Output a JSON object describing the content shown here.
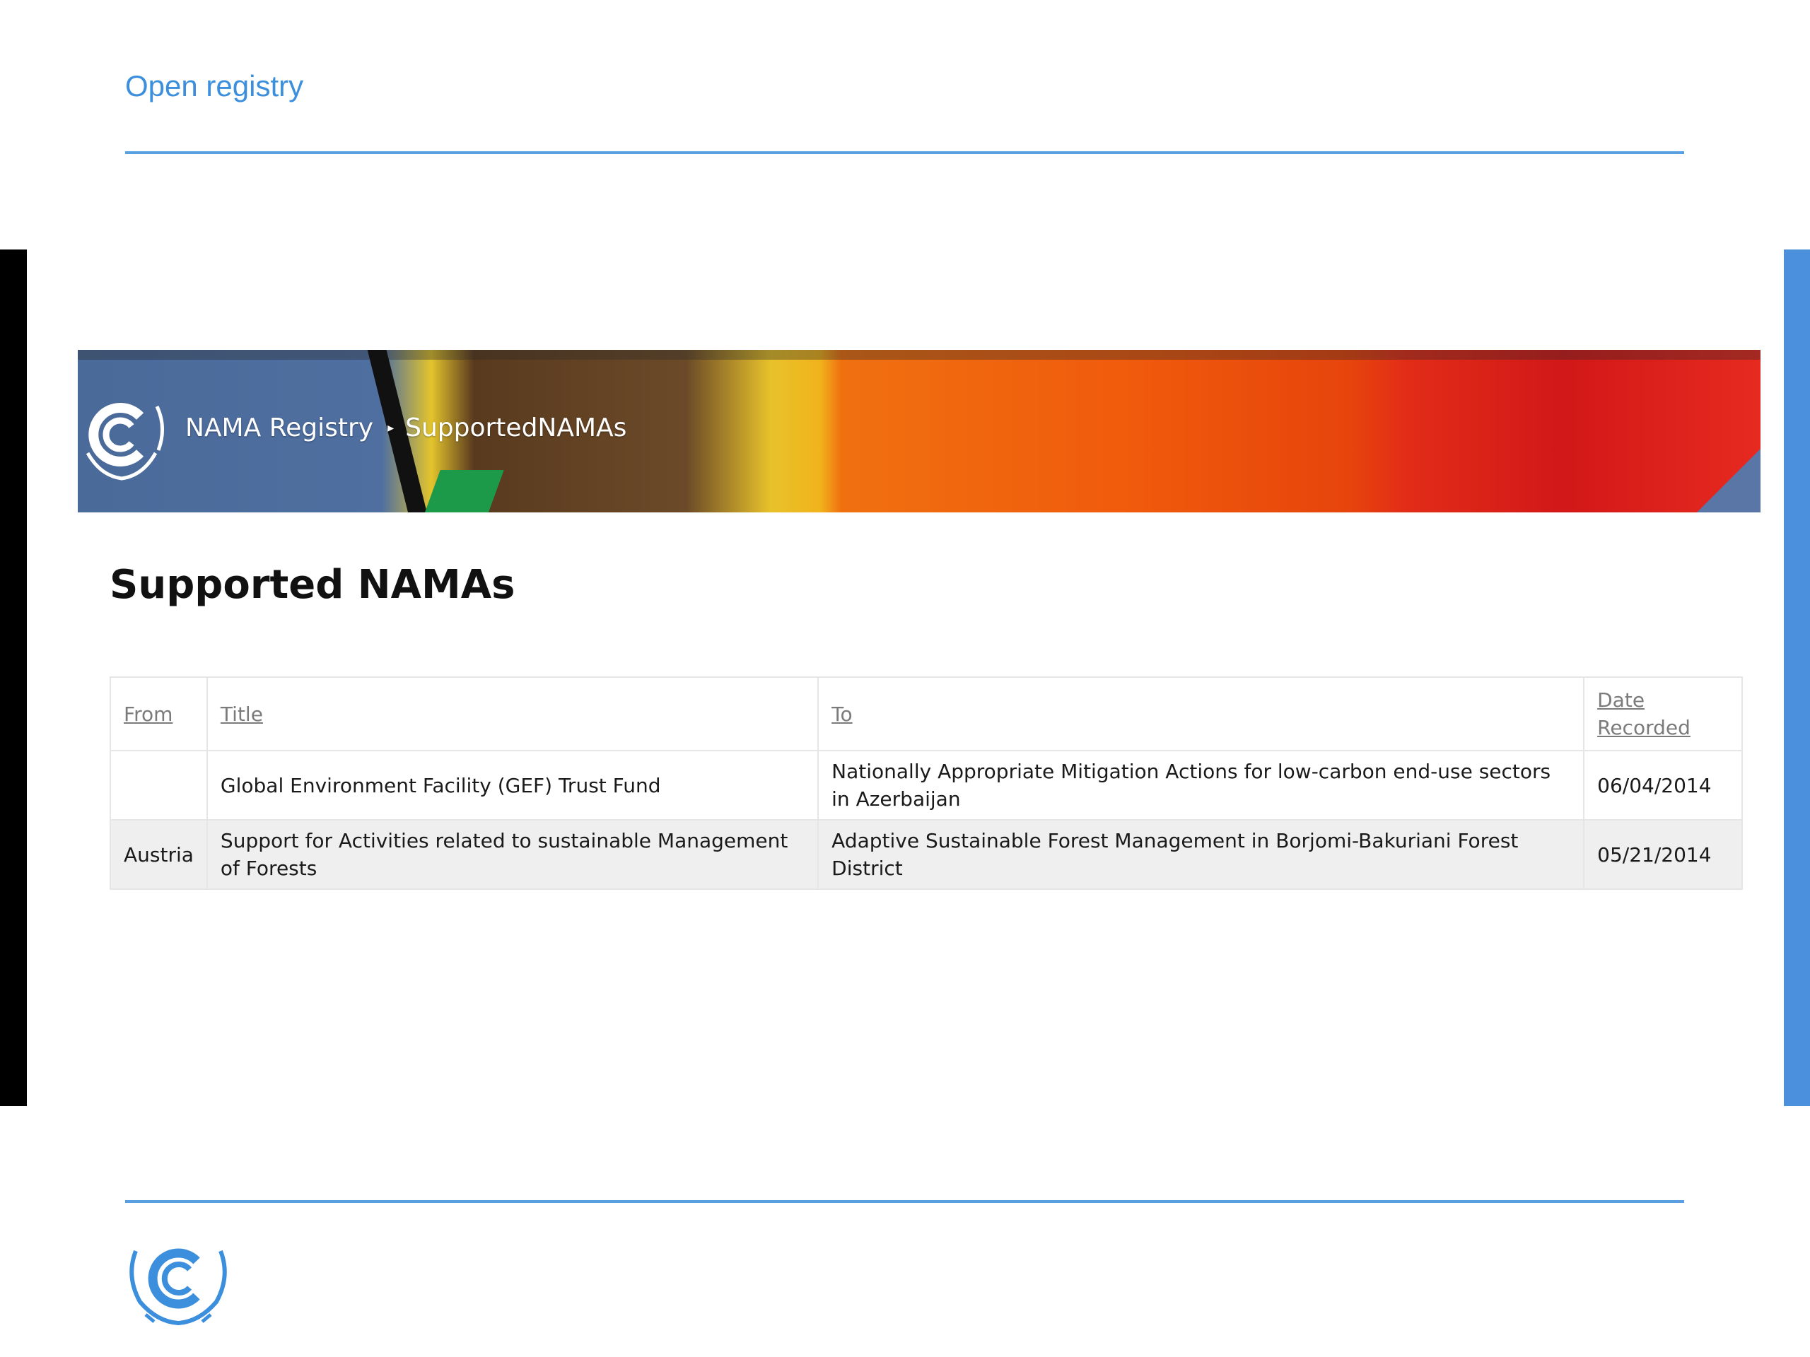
{
  "slide": {
    "title": "Open registry"
  },
  "banner": {
    "breadcrumb": [
      {
        "label": "NAMA Registry"
      },
      {
        "label": "SupportedNAMAs"
      }
    ]
  },
  "page": {
    "heading": "Supported NAMAs"
  },
  "table": {
    "headers": {
      "from": "From",
      "title": "Title",
      "to": "To",
      "date_recorded": "Date Recorded"
    },
    "rows": [
      {
        "from": "",
        "title": "Global Environment Facility (GEF) Trust Fund",
        "to": "Nationally Appropriate Mitigation Actions for low-carbon end-use sectors in Azerbaijan",
        "date_recorded": "06/04/2014"
      },
      {
        "from": "Austria",
        "title": "Support for Activities related to sustainable Management of Forests",
        "to": "Adaptive Sustainable Forest Management in Borjomi-Bakuriani Forest District",
        "date_recorded": "05/21/2014"
      }
    ]
  },
  "colors": {
    "accent": "#3b8fdc",
    "rule": "#5a9fe0",
    "right_bar": "#4a90dc"
  },
  "icons": {
    "banner_logo": "unfccc-logo-icon",
    "footer_logo": "unfccc-logo-icon"
  }
}
